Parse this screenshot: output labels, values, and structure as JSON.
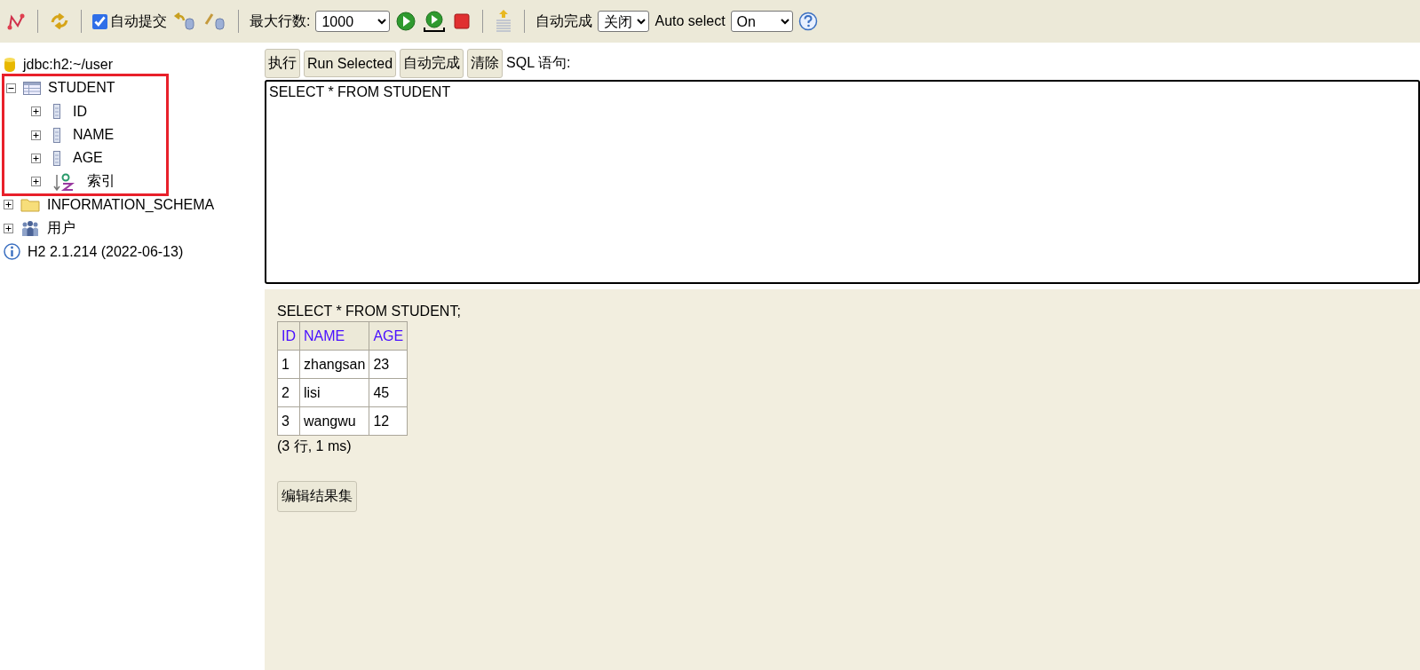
{
  "toolbar": {
    "autocommit": {
      "label": "自动提交",
      "checked": true
    },
    "max_rows": {
      "label": "最大行数:",
      "value": "1000"
    },
    "autocomplete": {
      "label": "自动完成",
      "value": "关闭"
    },
    "auto_select": {
      "label": "Auto select",
      "value": "On"
    }
  },
  "tree": [
    {
      "kind": "database",
      "label": "jdbc:h2:~/user"
    },
    {
      "kind": "table",
      "label": "STUDENT",
      "expanded": true,
      "children": [
        {
          "kind": "column",
          "label": "ID",
          "expanded": false
        },
        {
          "kind": "column",
          "label": "NAME",
          "expanded": false
        },
        {
          "kind": "column",
          "label": "AGE",
          "expanded": false
        },
        {
          "kind": "index",
          "label": "索引",
          "expanded": false
        }
      ]
    },
    {
      "kind": "folder",
      "label": "INFORMATION_SCHEMA",
      "expanded": false
    },
    {
      "kind": "users",
      "label": "用户",
      "expanded": false
    },
    {
      "kind": "info",
      "label": "H2 2.1.214 (2022-06-13)"
    }
  ],
  "query_buttons": [
    "执行",
    "Run Selected",
    "自动完成",
    "清除"
  ],
  "sql_label": "SQL 语句:",
  "sql_text": "SELECT * FROM STUDENT",
  "result": {
    "statement": "SELECT * FROM STUDENT;",
    "columns": [
      "ID",
      "NAME",
      "AGE"
    ],
    "rows": [
      [
        "1",
        "zhangsan",
        "23"
      ],
      [
        "2",
        "lisi",
        "45"
      ],
      [
        "3",
        "wangwu",
        "12"
      ]
    ],
    "summary": "(3 行, 1 ms)",
    "edit_button": "编辑结果集"
  }
}
